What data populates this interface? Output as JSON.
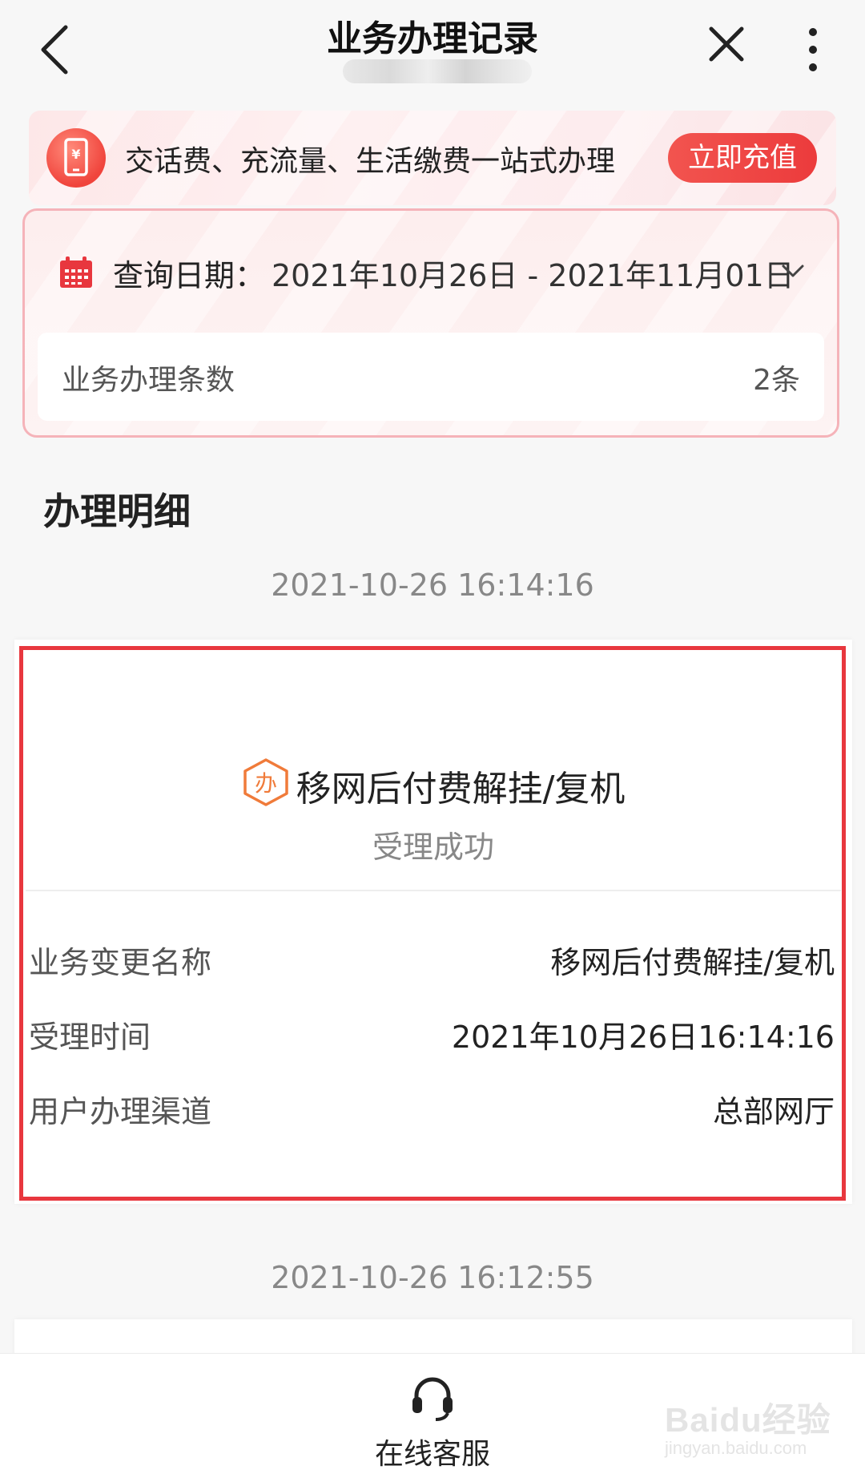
{
  "header": {
    "title": "业务办理记录",
    "subtitle_masked": true
  },
  "promo": {
    "text": "交话费、充流量、生活缴费一站式办理",
    "button_label": "立即充值",
    "accent_color": "#ec3b3c"
  },
  "query": {
    "label": "查询日期：",
    "date_range": "2021年10月26日 - 2021年11月01日",
    "count_label": "业务办理条数",
    "count_value": "2条"
  },
  "section_title": "办理明细",
  "records": [
    {
      "timestamp": "2021-10-26 16:14:16",
      "icon_char": "办",
      "title": "移网后付费解挂/复机",
      "status": "受理成功",
      "fields": [
        {
          "key": "业务变更名称",
          "value": "移网后付费解挂/复机"
        },
        {
          "key": "受理时间",
          "value": "2021年10月26日16:14:16"
        },
        {
          "key": "用户办理渠道",
          "value": "总部网厅"
        }
      ],
      "highlighted": true,
      "highlight_color": "#e8373e"
    },
    {
      "timestamp": "2021-10-26 16:12:55"
    }
  ],
  "bottom_bar": {
    "customer_service_label": "在线客服"
  },
  "watermark": {
    "brand": "Baidu经验",
    "url": "jingyan.baidu.com"
  }
}
